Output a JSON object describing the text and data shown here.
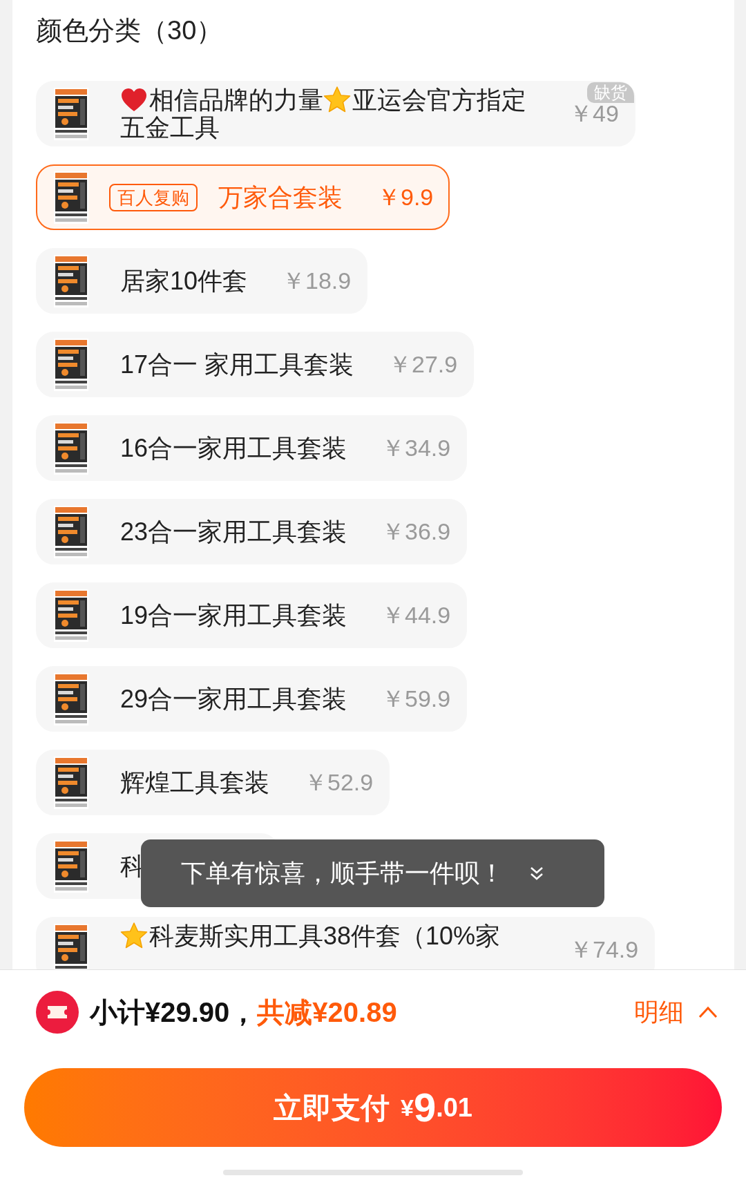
{
  "title": "颜色分类（30）",
  "options": [
    {
      "segments": [
        {
          "kind": "heart"
        },
        {
          "kind": "text",
          "text": "相信品牌的力量"
        },
        {
          "kind": "star"
        },
        {
          "kind": "text",
          "text": "亚运会官方指定五金工具"
        }
      ],
      "price": "￥49",
      "selected": false,
      "sold_out": true
    },
    {
      "segments": [
        {
          "kind": "text",
          "text": "万家合套装"
        }
      ],
      "tag": "百人复购",
      "price": "￥9.9",
      "selected": true,
      "sold_out": false
    },
    {
      "segments": [
        {
          "kind": "text",
          "text": "居家10件套"
        }
      ],
      "price": "￥18.9",
      "selected": false,
      "sold_out": false
    },
    {
      "segments": [
        {
          "kind": "text",
          "text": "17合一 家用工具套装"
        }
      ],
      "price": "￥27.9",
      "selected": false,
      "sold_out": false
    },
    {
      "segments": [
        {
          "kind": "text",
          "text": "16合一家用工具套装"
        }
      ],
      "price": "￥34.9",
      "selected": false,
      "sold_out": false
    },
    {
      "segments": [
        {
          "kind": "text",
          "text": "23合一家用工具套装"
        }
      ],
      "price": "￥36.9",
      "selected": false,
      "sold_out": false
    },
    {
      "segments": [
        {
          "kind": "text",
          "text": "19合一家用工具套装"
        }
      ],
      "price": "￥44.9",
      "selected": false,
      "sold_out": false
    },
    {
      "segments": [
        {
          "kind": "text",
          "text": "29合一家用工具套装"
        }
      ],
      "price": "￥59.9",
      "selected": false,
      "sold_out": false
    },
    {
      "segments": [
        {
          "kind": "text",
          "text": "辉煌工具套装"
        }
      ],
      "price": "￥52.9",
      "selected": false,
      "sold_out": false
    },
    {
      "segments": [
        {
          "kind": "text",
          "text": "科"
        }
      ],
      "selected": false,
      "sold_out": false
    },
    {
      "segments": [
        {
          "kind": "star"
        },
        {
          "kind": "text",
          "text": "科麦斯实用工具38件套（10%家"
        }
      ],
      "price": "￥74.9",
      "selected": false,
      "sold_out": false
    }
  ],
  "sold_out_label": "缺货",
  "toast": {
    "text": "下单有惊喜，顺手带一件呗！"
  },
  "summary": {
    "subtotal": "小计¥29.90，",
    "discount": "共减¥20.89",
    "details": "明细"
  },
  "pay_button": {
    "label": "立即支付",
    "currency": "¥",
    "integer": "9",
    "decimal": ".01"
  }
}
